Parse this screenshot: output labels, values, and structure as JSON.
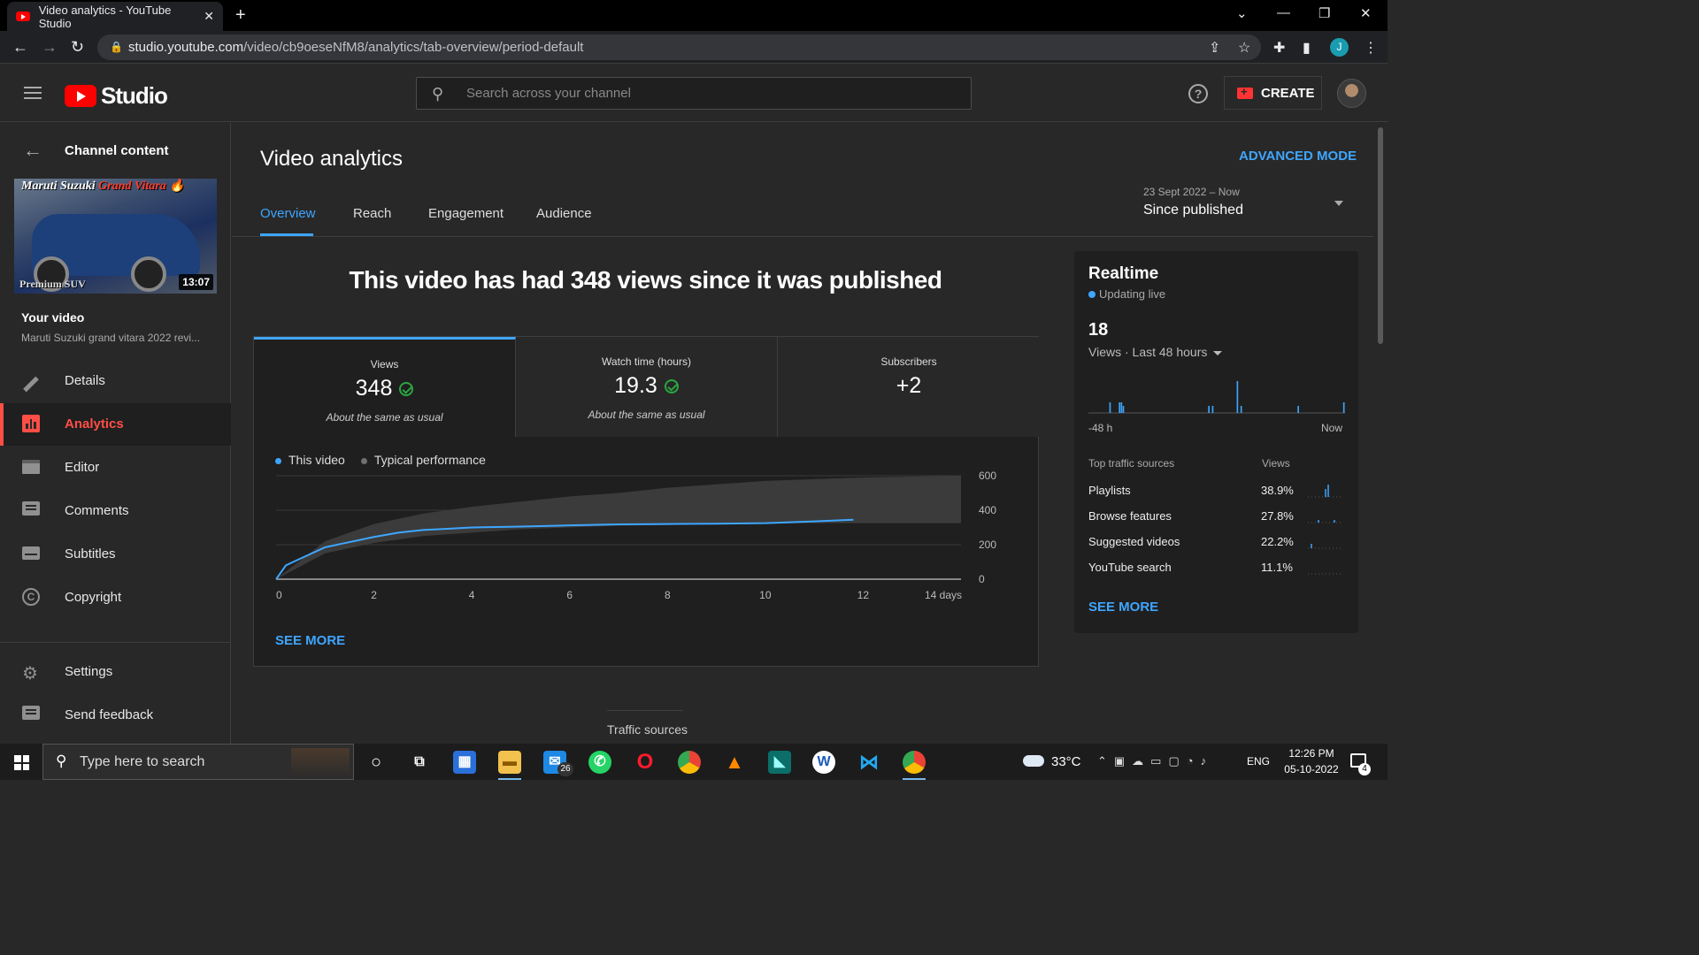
{
  "browser": {
    "tab_title": "Video analytics - YouTube Studio",
    "url_host": "studio.youtube.com",
    "url_path": "/video/cb9oeseNfM8/analytics/tab-overview/period-default",
    "profile_initial": "J"
  },
  "header": {
    "logo_text": "Studio",
    "search_placeholder": "Search across your channel",
    "create_label": "CREATE",
    "help_glyph": "?"
  },
  "sidebar": {
    "back_label": "Channel content",
    "thumbnail": {
      "title_part1": "Maruti Suzuki ",
      "title_part2": "Grand Vitara",
      "emoji": "🔥",
      "bottom_text": "Premium SUV",
      "duration": "13:07"
    },
    "your_video_label": "Your video",
    "video_title": "Maruti Suzuki grand vitara 2022 revi...",
    "items": [
      {
        "label": "Details",
        "icon": "pencil-icon"
      },
      {
        "label": "Analytics",
        "icon": "analytics-icon",
        "active": true
      },
      {
        "label": "Editor",
        "icon": "clapperboard-icon"
      },
      {
        "label": "Comments",
        "icon": "comment-icon"
      },
      {
        "label": "Subtitles",
        "icon": "subtitles-icon"
      },
      {
        "label": "Copyright",
        "icon": "copyright-icon"
      }
    ],
    "bottom_items": [
      {
        "label": "Settings",
        "icon": "gear-icon"
      },
      {
        "label": "Send feedback",
        "icon": "feedback-icon"
      }
    ]
  },
  "main": {
    "title": "Video analytics",
    "advanced_mode": "ADVANCED MODE",
    "tabs": [
      "Overview",
      "Reach",
      "Engagement",
      "Audience"
    ],
    "period": {
      "range": "23 Sept 2022 – Now",
      "selected": "Since published"
    },
    "headline": "This video has had 348 views since it was published",
    "metrics": [
      {
        "title": "Views",
        "value": "348",
        "note": "About the same as usual",
        "check": true
      },
      {
        "title": "Watch time (hours)",
        "value": "19.3",
        "note": "About the same as usual",
        "check": true
      },
      {
        "title": "Subscribers",
        "value": "+2",
        "note": "",
        "check": false
      }
    ],
    "see_more": "SEE MORE",
    "next_section": "Traffic sources"
  },
  "chart_data": {
    "type": "line",
    "series": [
      {
        "name": "This video",
        "color": "#3ea6ff",
        "x": [
          0,
          0.2,
          0.5,
          1.0,
          1.5,
          2.0,
          2.5,
          3.0,
          3.5,
          4.0,
          5.0,
          6.0,
          7.0,
          8.0,
          9.0,
          10.0,
          11.0,
          11.8
        ],
        "y": [
          0,
          80,
          120,
          185,
          215,
          245,
          270,
          285,
          292,
          300,
          305,
          312,
          318,
          320,
          322,
          325,
          335,
          345
        ]
      },
      {
        "name": "Typical performance",
        "color": "#606060",
        "x": [
          0,
          1,
          2,
          3,
          4,
          5,
          6,
          7,
          8,
          9,
          10,
          11,
          12,
          13,
          14
        ],
        "y_low": [
          0,
          150,
          210,
          250,
          270,
          290,
          300,
          310,
          315,
          320,
          322,
          325,
          325,
          325,
          325
        ],
        "y_high": [
          0,
          220,
          320,
          380,
          420,
          450,
          480,
          500,
          530,
          550,
          570,
          580,
          590,
          595,
          600
        ]
      }
    ],
    "x_ticks": [
      "0",
      "2",
      "4",
      "6",
      "8",
      "10",
      "12",
      "14 days"
    ],
    "x_tick_values": [
      0,
      2,
      4,
      6,
      8,
      10,
      12,
      14
    ],
    "y_ticks": [
      "600",
      "400",
      "200",
      "0"
    ],
    "y_tick_values": [
      600,
      400,
      200,
      0
    ],
    "xlim": [
      0,
      14
    ],
    "ylim": [
      0,
      600
    ],
    "grid": true,
    "legend_position": "top-left"
  },
  "realtime": {
    "title": "Realtime",
    "live_label": "Updating live",
    "count": "18",
    "period_label": "Views · Last 48 hours",
    "axis_left": "-48 h",
    "axis_right": "Now",
    "bars": [
      0,
      0,
      0,
      0,
      0,
      0,
      0,
      0,
      0,
      0,
      0,
      3,
      0,
      0,
      0,
      0,
      3,
      3,
      2,
      0,
      0,
      0,
      0,
      0,
      0,
      0,
      0,
      0,
      0,
      0,
      0,
      0,
      0,
      0,
      0,
      0,
      0,
      0,
      0,
      0,
      0,
      0,
      0,
      0,
      0,
      0,
      0,
      0,
      0,
      0,
      0,
      0,
      0,
      0,
      0,
      0,
      0,
      0,
      0,
      0,
      0,
      0,
      0,
      2,
      0,
      2,
      0,
      0,
      0,
      0,
      0,
      0,
      0,
      0,
      0,
      0,
      0,
      0,
      9,
      0,
      2,
      0,
      0,
      0,
      0,
      0,
      0,
      0,
      0,
      0,
      0,
      0,
      0,
      0,
      0,
      0,
      0,
      0,
      0,
      0,
      0,
      0,
      0,
      0,
      0,
      0,
      0,
      0,
      0,
      0,
      2,
      0,
      0,
      0,
      0,
      0,
      0,
      0,
      0,
      0,
      0,
      0,
      0,
      0,
      0,
      0,
      0,
      0,
      0,
      0,
      0,
      0,
      0,
      0,
      3
    ],
    "sources_header": "Top traffic sources",
    "views_header": "Views",
    "sources": [
      {
        "name": "Playlists",
        "pct": "38.9%"
      },
      {
        "name": "Browse features",
        "pct": "27.8%"
      },
      {
        "name": "Suggested videos",
        "pct": "22.2%"
      },
      {
        "name": "YouTube search",
        "pct": "11.1%"
      }
    ],
    "see_more": "SEE MORE"
  },
  "taskbar": {
    "search_placeholder": "Type here to search",
    "mail_badge": "26",
    "temperature": "33°C",
    "language": "ENG",
    "time": "12:26 PM",
    "date": "05-10-2022",
    "notification_count": "4"
  }
}
